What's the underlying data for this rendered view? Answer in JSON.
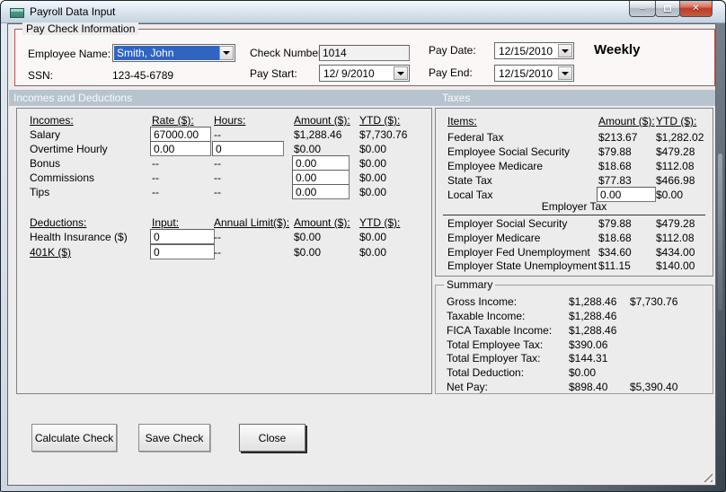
{
  "window": {
    "title": "Payroll Data Input",
    "controls": {
      "minimize": "–",
      "maximize": "",
      "close": "✕"
    }
  },
  "paycheck_info": {
    "group_title": "Pay Check Information",
    "employee_name_label": "Employee Name:",
    "employee_name_value": "Smith, John",
    "ssn_label": "SSN:",
    "ssn_value": "123-45-6789",
    "check_number_label": "Check Number:",
    "check_number_value": "1014",
    "pay_start_label": "Pay Start:",
    "pay_start_value": "12/ 9/2010",
    "pay_date_label": "Pay Date:",
    "pay_date_value": "12/15/2010",
    "pay_end_label": "Pay End:",
    "pay_end_value": "12/15/2010",
    "frequency": "Weekly"
  },
  "sections": {
    "incomes_deductions_header": "Incomes and Deductions",
    "taxes_header": "Taxes"
  },
  "incomes": {
    "headers": {
      "item": "Incomes:",
      "rate": "Rate ($):",
      "hours": "Hours:",
      "amount": "Amount ($):",
      "ytd": "YTD ($):"
    },
    "rows": [
      {
        "label": "Salary",
        "rate": "67000.00",
        "hours": "--",
        "amount": "$1,288.46",
        "ytd": "$7,730.76"
      },
      {
        "label": "Overtime Hourly",
        "rate": "0.00",
        "hours": "0",
        "amount": "$0.00",
        "ytd": "$0.00"
      },
      {
        "label": "Bonus",
        "rate": "--",
        "hours": "--",
        "amount": "0.00",
        "ytd": "$0.00"
      },
      {
        "label": "Commissions",
        "rate": "--",
        "hours": "--",
        "amount": "0.00",
        "ytd": "$0.00"
      },
      {
        "label": "Tips",
        "rate": "--",
        "hours": "--",
        "amount": "0.00",
        "ytd": "$0.00"
      }
    ]
  },
  "deductions": {
    "headers": {
      "item": "Deductions:",
      "input": "Input:",
      "limit": "Annual Limit($):",
      "amount": "Amount ($):",
      "ytd": "YTD ($):"
    },
    "rows": [
      {
        "label": "Health Insurance  ($)",
        "input": "0",
        "limit": "--",
        "amount": "$0.00",
        "ytd": "$0.00"
      },
      {
        "label": "401K  ($)",
        "input": "0",
        "limit": "--",
        "amount": "$0.00",
        "ytd": "$0.00"
      }
    ]
  },
  "taxes": {
    "headers": {
      "item": "Items:",
      "amount": "Amount ($):",
      "ytd": "YTD ($):"
    },
    "employee_rows": [
      {
        "label": "Federal Tax",
        "amount": "$213.67",
        "ytd": "$1,282.02"
      },
      {
        "label": "Employee Social Security",
        "amount": "$79.88",
        "ytd": "$479.28"
      },
      {
        "label": "Employee Medicare",
        "amount": "$18.68",
        "ytd": "$112.08"
      },
      {
        "label": "State Tax",
        "amount": "$77.83",
        "ytd": "$466.98"
      },
      {
        "label": "Local Tax",
        "amount": "0.00",
        "ytd": "$0.00"
      }
    ],
    "employer_header": "Employer Tax",
    "employer_rows": [
      {
        "label": "Employer Social Security",
        "amount": "$79.88",
        "ytd": "$479.28"
      },
      {
        "label": "Employer Medicare",
        "amount": "$18.68",
        "ytd": "$112.08"
      },
      {
        "label": "Employer Fed Unemployment",
        "amount": "$34.60",
        "ytd": "$434.00"
      },
      {
        "label": "Employer State Unemployment",
        "amount": "$11.15",
        "ytd": "$140.00"
      }
    ]
  },
  "summary": {
    "group_title": "Summary",
    "rows": [
      {
        "label": "Gross Income:",
        "amount": "$1,288.46",
        "ytd": "$7,730.76"
      },
      {
        "label": "Taxable Income:",
        "amount": "$1,288.46",
        "ytd": ""
      },
      {
        "label": "FICA Taxable Income:",
        "amount": "$1,288.46",
        "ytd": ""
      },
      {
        "label": "Total Employee Tax:",
        "amount": "$390.06",
        "ytd": ""
      },
      {
        "label": "Total Employer Tax:",
        "amount": "$144.31",
        "ytd": ""
      },
      {
        "label": "Total Deduction:",
        "amount": "$0.00",
        "ytd": ""
      },
      {
        "label": "Net Pay:",
        "amount": "$898.40",
        "ytd": "$5,390.40"
      }
    ]
  },
  "buttons": {
    "calculate": "Calculate Check",
    "save": "Save Check",
    "close": "Close"
  },
  "colors": {
    "client_bg": "#ececec",
    "section_header_bg": "#b7c4cf",
    "paycheck_border_red": "#b85050",
    "selection_blue": "#2f64c1",
    "close_button_red": "#bc3d28",
    "titlebar_top": "#f4f8fc",
    "titlebar_bottom": "#c6d2e0"
  }
}
